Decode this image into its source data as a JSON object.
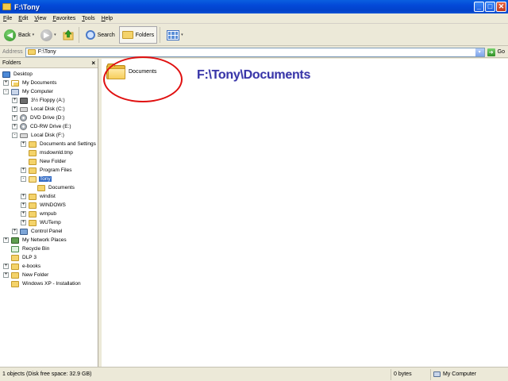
{
  "window": {
    "title": "F:\\Tony",
    "buttons": {
      "minimize": "_",
      "maximize": "□",
      "close": "✕"
    }
  },
  "menu": [
    "File",
    "Edit",
    "View",
    "Favorites",
    "Tools",
    "Help"
  ],
  "toolbar": {
    "back": "Back",
    "search": "Search",
    "folders": "Folders",
    "dropdown": "▾"
  },
  "address": {
    "label": "Address",
    "value": "F:\\Tony",
    "go": "Go"
  },
  "folders_pane": {
    "title": "Folders",
    "close": "×",
    "tree": [
      {
        "label": "Desktop",
        "icon": "desktop-icon",
        "expander": ""
      },
      {
        "label": "My Documents",
        "icon": "my-documents-icon",
        "expander": "+"
      },
      {
        "label": "My Computer",
        "icon": "my-computer-icon",
        "expander": "-"
      },
      {
        "label": "3½ Floppy (A:)",
        "icon": "floppy-icon",
        "expander": "+"
      },
      {
        "label": "Local Disk (C:)",
        "icon": "hard-drive-icon",
        "expander": "+"
      },
      {
        "label": "DVD Drive (D:)",
        "icon": "dvd-drive-icon",
        "expander": "+"
      },
      {
        "label": "CD-RW Drive (E:)",
        "icon": "cd-drive-icon",
        "expander": "+"
      },
      {
        "label": "Local Disk (F:)",
        "icon": "hard-drive-icon",
        "expander": "-"
      },
      {
        "label": "Documents and Settings",
        "icon": "folder-icon",
        "expander": "+"
      },
      {
        "label": "msdownld.tmp",
        "icon": "folder-icon",
        "expander": ""
      },
      {
        "label": "New Folder",
        "icon": "folder-icon",
        "expander": ""
      },
      {
        "label": "Program Files",
        "icon": "folder-icon",
        "expander": "+"
      },
      {
        "label": "Tony",
        "icon": "open-folder-icon",
        "expander": "-"
      },
      {
        "label": "Documents",
        "icon": "folder-icon",
        "expander": ""
      },
      {
        "label": "windist",
        "icon": "folder-icon",
        "expander": "+"
      },
      {
        "label": "WINDOWS",
        "icon": "folder-icon",
        "expander": "+"
      },
      {
        "label": "wmpub",
        "icon": "folder-icon",
        "expander": "+"
      },
      {
        "label": "WUTemp",
        "icon": "folder-icon",
        "expander": "+"
      },
      {
        "label": "Control Panel",
        "icon": "control-panel-icon",
        "expander": "+"
      },
      {
        "label": "My Network Places",
        "icon": "network-places-icon",
        "expander": "+"
      },
      {
        "label": "Recycle Bin",
        "icon": "recycle-bin-icon",
        "expander": ""
      },
      {
        "label": "DLP 3",
        "icon": "folder-icon",
        "expander": ""
      },
      {
        "label": "e-books",
        "icon": "folder-icon",
        "expander": "+"
      },
      {
        "label": "New Folder",
        "icon": "folder-icon",
        "expander": "+"
      },
      {
        "label": "Windows XP - Installation",
        "icon": "folder-icon",
        "expander": ""
      }
    ],
    "selected": "Tony"
  },
  "content": {
    "items": [
      {
        "label": "Documents",
        "icon": "folder-icon"
      }
    ],
    "annotation": "F:\\Tony\\Documents",
    "annotation_color": "#3a37a8",
    "highlight_color": "#e01010"
  },
  "status": {
    "objects": "1 objects (Disk free space: 32.9 GB)",
    "size": "0 bytes",
    "location": "My Computer"
  }
}
